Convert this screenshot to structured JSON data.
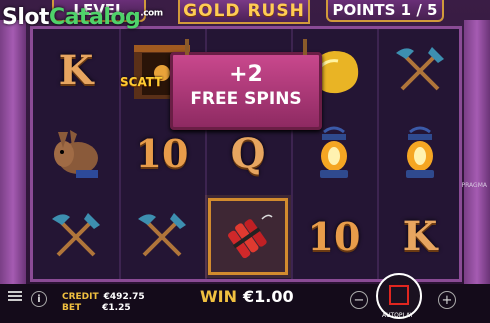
{
  "watermark": {
    "slot": "Slot",
    "catalog": "Catalog",
    "com": ".com"
  },
  "topbar": {
    "level_label": "LEVEL",
    "title": "GOLD RUSH",
    "points_label": "POINTS 1 / 5"
  },
  "popup": {
    "line1": "+2",
    "line2": "FREE SPINS"
  },
  "scatter_label": "SCATT",
  "reels": [
    [
      {
        "sym": "K",
        "kind": "letter"
      },
      {
        "sym": "donkey",
        "kind": "icon"
      },
      {
        "sym": "pickaxe-shovel",
        "kind": "icon"
      }
    ],
    [
      {
        "sym": "scatter",
        "kind": "icon"
      },
      {
        "sym": "10",
        "kind": "num"
      },
      {
        "sym": "pickaxe-shovel",
        "kind": "icon"
      }
    ],
    [
      {
        "sym": "donkey",
        "kind": "icon"
      },
      {
        "sym": "Q",
        "kind": "letter"
      },
      {
        "sym": "dynamite",
        "kind": "icon"
      }
    ],
    [
      {
        "sym": "gold-nugget",
        "kind": "icon"
      },
      {
        "sym": "lantern",
        "kind": "icon"
      },
      {
        "sym": "10",
        "kind": "num"
      }
    ],
    [
      {
        "sym": "pickaxe-shovel",
        "kind": "icon"
      },
      {
        "sym": "lantern",
        "kind": "icon"
      },
      {
        "sym": "K",
        "kind": "letter"
      }
    ]
  ],
  "bottom": {
    "credit_label": "CREDIT",
    "credit_value": "€492.75",
    "bet_label": "BET",
    "bet_value": "€1.25",
    "win_label": "WIN",
    "win_value": "€1.00",
    "autoplay_label": "AUTOPLAY",
    "minus": "−",
    "plus": "+",
    "info": "i"
  },
  "provider": "PRAGMA"
}
